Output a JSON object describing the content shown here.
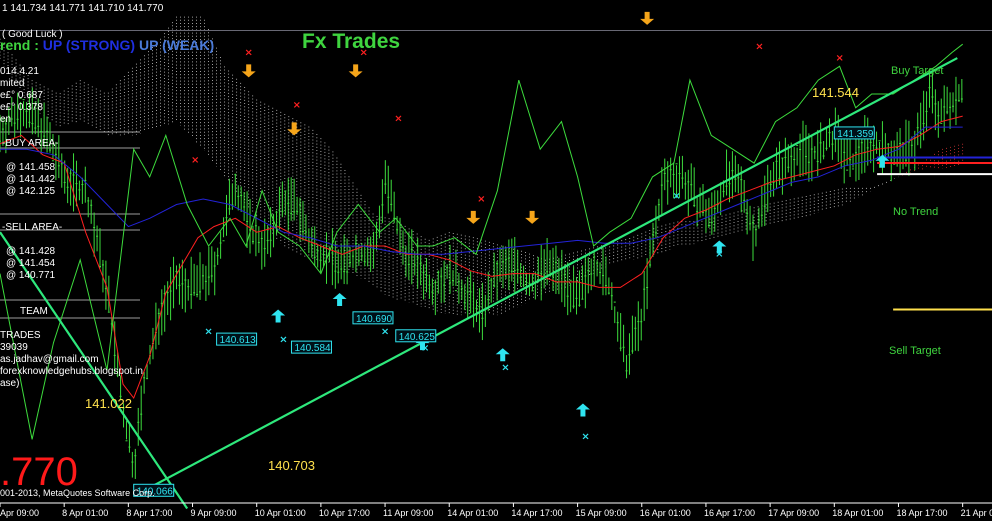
{
  "header": {
    "ohlc": "1  141.734 141.771 141.710 141.770",
    "good_luck": "( Good Luck )",
    "trend_prefix": "rend : ",
    "trend_strong": "UP (STRONG)",
    "trend_weak": "UP (WEAK)",
    "title": "Fx Trades"
  },
  "left_panel": {
    "info": [
      "014.4.21",
      "mited",
      "e£° 0.687",
      "e£° 0.378",
      "en"
    ],
    "buy_area": "-BUY AREA-",
    "buy_levels": [
      "@ 141.458",
      "@ 141.442",
      "@ 142.125"
    ],
    "sell_area": "-SELL AREA-",
    "sell_levels": [
      "@ 141.428",
      "@ 141.454",
      "@ 140.771"
    ],
    "team": "TEAM",
    "contact": [
      "TRADES",
      "39039",
      "as.jadhav@gmail.com",
      "forexknowledgehubs.blogspot.in",
      "ase)"
    ]
  },
  "big_price": ".770",
  "copyright": "001-2013, MetaQuotes Software Corp.",
  "targets": {
    "buy": "Buy Target",
    "sell": "Sell Target",
    "no_trend": "No Trend",
    "colors": {
      "buy": "#2fe4f0",
      "sell": "#ffe14d",
      "buy_text": "#3fd43f"
    }
  },
  "levels": {
    "top": "141.544",
    "left_mid": "141.022",
    "bottom": "140.703"
  },
  "chart_data": {
    "type": "line",
    "title": "Fx Trades",
    "ylim": [
      140.02,
      141.84
    ],
    "x_tick_labels": [
      "Apr 09:00",
      "8 Apr 01:00",
      "8 Apr 17:00",
      "9 Apr 09:00",
      "10 Apr 01:00",
      "10 Apr 17:00",
      "11 Apr 09:00",
      "14 Apr 01:00",
      "14 Apr 17:00",
      "15 Apr 09:00",
      "16 Apr 01:00",
      "16 Apr 17:00",
      "17 Apr 09:00",
      "18 Apr 01:00",
      "18 Apr 17:00",
      "21 Apr 09:00"
    ],
    "x_ticks": [
      0,
      24,
      48,
      72,
      96,
      120,
      144,
      168,
      192,
      216,
      240,
      264,
      288,
      312,
      336,
      360
    ],
    "series": [
      {
        "x": [
          0,
          8,
          16,
          24,
          32,
          40,
          46,
          50,
          54,
          60,
          66,
          72,
          80,
          88,
          94,
          100,
          106,
          112,
          116,
          122,
          128,
          134,
          140,
          144,
          150,
          156,
          162,
          168,
          174,
          180,
          186,
          192,
          198,
          204,
          210,
          216,
          222,
          228,
          234,
          240,
          244,
          248,
          254,
          260,
          266,
          272,
          278,
          282,
          288,
          294,
          300,
          306,
          312,
          318,
          324,
          330,
          336,
          342,
          348,
          352,
          356,
          360
        ],
        "values": [
          141.36,
          141.45,
          141.38,
          141.2,
          141.15,
          140.8,
          140.35,
          140.15,
          140.45,
          140.72,
          140.82,
          140.8,
          140.86,
          141.18,
          141.0,
          140.95,
          141.12,
          141.08,
          140.95,
          140.92,
          140.88,
          140.93,
          140.92,
          141.2,
          140.95,
          140.88,
          140.8,
          140.86,
          140.78,
          140.7,
          140.85,
          140.9,
          140.8,
          140.88,
          140.85,
          140.74,
          140.9,
          140.8,
          140.52,
          140.7,
          140.95,
          141.18,
          141.22,
          141.12,
          141.05,
          141.2,
          141.15,
          140.98,
          141.2,
          141.25,
          141.3,
          141.28,
          141.35,
          141.24,
          141.33,
          141.3,
          141.28,
          141.32,
          141.5,
          141.42,
          141.48,
          141.52
        ],
        "color": "#3ddc3d"
      },
      {
        "x": [
          0,
          8,
          16,
          24,
          32,
          40,
          46,
          50,
          56,
          62,
          68,
          74,
          80,
          88,
          96,
          104,
          112,
          120,
          128,
          136,
          144,
          152,
          160,
          168,
          176,
          184,
          192,
          200,
          208,
          216,
          224,
          232,
          240,
          248,
          256,
          264,
          272,
          280,
          288,
          296,
          304,
          312,
          320,
          328,
          336,
          344,
          352,
          360
        ],
        "values": [
          141.32,
          141.35,
          141.28,
          141.25,
          141.0,
          140.8,
          140.45,
          140.4,
          140.55,
          140.78,
          140.88,
          140.98,
          141.02,
          141.05,
          141.0,
          141.02,
          140.98,
          140.95,
          140.92,
          140.95,
          140.95,
          140.92,
          140.92,
          140.9,
          140.86,
          140.84,
          140.85,
          140.85,
          140.82,
          140.82,
          140.8,
          140.8,
          140.85,
          140.98,
          141.05,
          141.08,
          141.12,
          141.15,
          141.18,
          141.2,
          141.22,
          141.24,
          141.28,
          141.3,
          141.31,
          141.35,
          141.4,
          141.42
        ],
        "color": "#ff2020"
      },
      {
        "x": [
          0,
          10,
          20,
          30,
          40,
          48,
          56,
          66,
          76,
          86,
          96,
          106,
          116,
          126,
          136,
          146,
          156,
          166,
          176,
          186,
          196,
          206,
          216,
          226,
          236,
          246,
          256,
          266,
          276,
          286,
          296,
          306,
          316,
          326,
          336,
          346,
          352,
          360
        ],
        "values": [
          141.3,
          141.3,
          141.28,
          141.2,
          141.1,
          141.02,
          141.05,
          141.1,
          141.12,
          141.1,
          141.05,
          141.0,
          140.98,
          140.95,
          140.95,
          140.93,
          140.92,
          140.92,
          140.93,
          140.94,
          140.95,
          140.96,
          140.97,
          140.96,
          140.96,
          140.98,
          141.02,
          141.06,
          141.1,
          141.14,
          141.18,
          141.2,
          141.24,
          141.26,
          141.3,
          141.38,
          141.38,
          141.38
        ],
        "color": "#2323d8"
      },
      {
        "x": [
          0,
          6,
          12,
          20,
          30,
          40,
          50,
          56,
          62,
          70,
          78,
          86,
          92,
          98,
          104,
          112,
          120,
          126,
          134,
          142,
          148,
          156,
          162,
          170,
          178,
          186,
          194,
          202,
          210,
          216,
          222,
          228,
          236,
          244,
          252,
          258,
          266,
          274,
          282,
          290,
          298,
          306,
          314,
          320,
          326,
          334,
          342,
          350,
          356,
          360
        ],
        "values": [
          140.85,
          140.55,
          140.25,
          140.6,
          140.9,
          140.5,
          141.3,
          141.2,
          141.35,
          141.1,
          140.95,
          141.05,
          140.95,
          141.15,
          141.0,
          140.95,
          140.85,
          141.0,
          141.1,
          141.0,
          141.05,
          140.95,
          140.95,
          140.98,
          140.92,
          141.15,
          141.55,
          141.3,
          141.4,
          141.2,
          140.95,
          141.0,
          141.05,
          141.2,
          141.25,
          141.55,
          141.35,
          141.3,
          141.25,
          141.4,
          141.45,
          141.55,
          141.6,
          141.45,
          141.5,
          141.5,
          141.55,
          141.6,
          141.65,
          141.68
        ],
        "color": "#3ddc3d"
      },
      {
        "x": [
          0,
          12,
          22,
          30,
          40,
          50,
          60,
          66,
          76,
          84,
          96,
          106,
          116,
          124,
          134,
          140,
          146,
          152,
          160,
          168,
          178,
          188,
          196,
          204,
          212,
          220,
          228,
          236,
          246,
          254,
          262,
          270,
          278,
          286,
          296,
          306,
          316,
          326,
          336,
          346,
          352,
          360
        ],
        "values": [
          141.7,
          141.55,
          141.5,
          141.55,
          141.5,
          141.6,
          141.7,
          141.78,
          141.78,
          141.6,
          141.48,
          141.43,
          141.38,
          141.3,
          141.15,
          141.06,
          141.05,
          141.02,
          140.97,
          141.0,
          140.98,
          140.95,
          140.93,
          140.9,
          140.92,
          140.94,
          140.96,
          140.98,
          141.02,
          141.04,
          141.04,
          141.06,
          141.08,
          141.1,
          141.12,
          141.14,
          141.16,
          141.16,
          141.2,
          141.23,
          141.23,
          141.24
        ],
        "color": "#ffffff"
      },
      {
        "x": [
          0,
          12,
          22,
          30,
          40,
          50,
          60,
          66,
          76,
          84,
          96,
          106,
          116,
          124,
          134,
          140,
          146,
          152,
          160,
          168,
          178,
          188,
          196,
          204,
          212,
          220,
          228,
          236,
          246,
          254,
          262,
          270,
          278,
          286,
          296,
          306,
          316,
          326,
          336,
          346,
          352,
          360
        ],
        "values": [
          141.62,
          141.45,
          141.38,
          141.4,
          141.35,
          141.35,
          141.38,
          141.4,
          141.3,
          141.2,
          141.05,
          140.95,
          140.9,
          140.88,
          140.84,
          140.8,
          140.76,
          140.75,
          140.72,
          140.7,
          140.7,
          140.7,
          140.74,
          140.78,
          140.8,
          140.84,
          140.88,
          140.9,
          140.92,
          140.95,
          140.96,
          140.98,
          141.0,
          141.02,
          141.04,
          141.07,
          141.1,
          141.15,
          141.2,
          141.26,
          141.3,
          141.32
        ],
        "color": "#ff2020"
      }
    ],
    "trend_lines": [
      {
        "x": [
          51,
          358
        ],
        "values": [
          140.05,
          141.63
        ],
        "color": "#2ee87c"
      },
      {
        "x": [
          0,
          70
        ],
        "values": [
          141.0,
          140.0
        ],
        "color": "#2ee87c"
      }
    ],
    "h_lines": [
      {
        "y": 141.73,
        "color": "#8a8a9a",
        "x_from": 0
      },
      {
        "y": 141.21,
        "color": "#ffffff",
        "x_from": 328
      },
      {
        "y": 141.25,
        "color": "#ff2020",
        "x_from": 328
      },
      {
        "y": 141.27,
        "color": "#2323d8",
        "x_from": 328
      },
      {
        "y": 142.05,
        "color": "#2fe4f0",
        "x_from": 334
      },
      {
        "y": 140.72,
        "color": "#ffe14d",
        "x_from": 334
      }
    ],
    "sell_arrows": [
      {
        "x": 9,
        "y": 141.98
      },
      {
        "x": 93,
        "y": 141.56
      },
      {
        "x": 110,
        "y": 141.35
      },
      {
        "x": 133,
        "y": 141.56
      },
      {
        "x": 177,
        "y": 141.03
      },
      {
        "x": 199,
        "y": 141.03
      },
      {
        "x": 242,
        "y": 141.75
      },
      {
        "x": 336,
        "y": 141.85
      }
    ],
    "buy_arrows": [
      {
        "x": 104,
        "y": 140.72
      },
      {
        "x": 127,
        "y": 140.78
      },
      {
        "x": 158,
        "y": 140.62
      },
      {
        "x": 188,
        "y": 140.58
      },
      {
        "x": 218,
        "y": 140.38
      },
      {
        "x": 269,
        "y": 140.97
      },
      {
        "x": 330,
        "y": 141.28
      }
    ],
    "sell_markers": [
      {
        "x": 93,
        "y": 141.64
      },
      {
        "x": 111,
        "y": 141.45
      },
      {
        "x": 136,
        "y": 141.64
      },
      {
        "x": 149,
        "y": 141.4
      },
      {
        "x": 73,
        "y": 141.25
      },
      {
        "x": 180,
        "y": 141.11
      },
      {
        "x": 243,
        "y": 141.84
      },
      {
        "x": 284,
        "y": 141.66
      },
      {
        "x": 314,
        "y": 141.62
      },
      {
        "x": 336,
        "y": 141.92
      }
    ],
    "buy_markers": [
      {
        "x": 78,
        "y": 140.63
      },
      {
        "x": 106,
        "y": 140.6
      },
      {
        "x": 144,
        "y": 140.63
      },
      {
        "x": 159,
        "y": 140.57
      },
      {
        "x": 189,
        "y": 140.5
      },
      {
        "x": 219,
        "y": 140.25
      },
      {
        "x": 253,
        "y": 141.12
      },
      {
        "x": 269,
        "y": 140.91
      }
    ],
    "price_boxes": [
      {
        "x": 81,
        "y": 140.613,
        "label": "140.613"
      },
      {
        "x": 109,
        "y": 140.584,
        "label": "140.584"
      },
      {
        "x": 132,
        "y": 140.69,
        "label": "140.690"
      },
      {
        "x": 148,
        "y": 140.625,
        "label": "140.625"
      },
      {
        "x": 50,
        "y": 140.066,
        "label": "140.066"
      },
      {
        "x": 312,
        "y": 141.359,
        "label": "141.359"
      }
    ]
  }
}
